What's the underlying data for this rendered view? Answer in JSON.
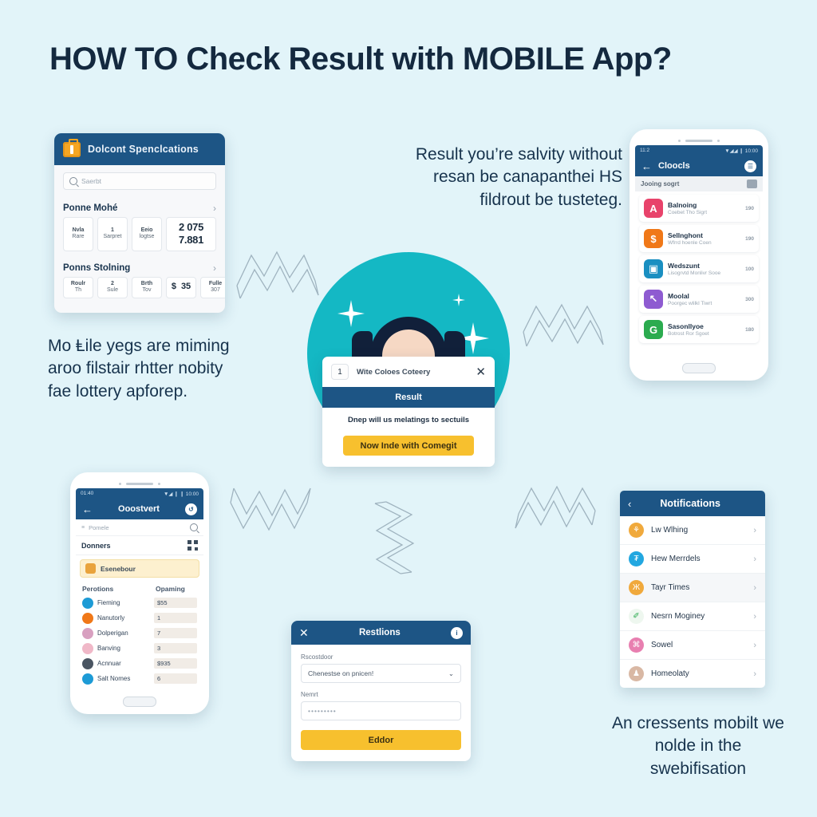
{
  "page": {
    "title": "HOW TO Check Result with MOBILE App?",
    "background_color": "#e2f4f9",
    "accent_blue": "#1d5585",
    "accent_yellow": "#f7c02e",
    "accent_teal": "#14b8c4"
  },
  "captions": {
    "top_right": "Result you’re salvity without resan be canapanthei HS fildrout be tusteteg.",
    "left": "Mo Ⱡile yegs are miming aroo filstair rhtter nobity fae lottery apforep.",
    "bottom_right": "An cressents mobilt we nolde in the swebifisation"
  },
  "specs_card": {
    "header_title": "Dolcont Spenclcations",
    "header_icon": "briefcase-icon",
    "search_placeholder": "Saerbt",
    "search_icon": "search-icon",
    "sections": [
      {
        "name": "Ponne Mohé",
        "chevron": "›",
        "chips": [
          {
            "l1": "Nvla",
            "l2": "Rare"
          },
          {
            "l1": "1",
            "l2": "Sarpret"
          },
          {
            "l1": "Eeio",
            "l2": "logtse"
          }
        ],
        "value": "2 075 7.881"
      },
      {
        "name": "Ponns Stolning",
        "chevron": "›",
        "chips": [
          {
            "l1": "Roulr",
            "l2": "Th"
          },
          {
            "l1": "2",
            "l2": "Sule"
          },
          {
            "l1": "Brth",
            "l2": "Tov"
          }
        ],
        "currency": "$",
        "amount": "35",
        "last_chip": {
          "l1": "Fulle",
          "l2": "307"
        }
      }
    ]
  },
  "phone_right": {
    "status_time": "11:2",
    "status_icons": "▼◢◢ ❙ 10:00",
    "appbar_title": "Cloocls",
    "back_icon": "back-arrow-icon",
    "action_icon": "filter-icon",
    "subhead": "Jooing sogrt",
    "subhead_icon": "sort-icon",
    "rows": [
      {
        "letter": "A",
        "color": "#e8436b",
        "title": "Balnoing",
        "subtitle": "Coebet Tho Sigrt",
        "meta": "190"
      },
      {
        "letter": "$",
        "color": "#f07818",
        "title": "Sellnghont",
        "subtitle": "Wfrrd hoenle Coen",
        "meta": "190"
      },
      {
        "letter": "▣",
        "color": "#1a8fc1",
        "title": "Wedszunt",
        "subtitle": "Lisogrvtd Monlivr Sooe",
        "meta": "100"
      },
      {
        "letter": "↖",
        "color": "#8e5bd1",
        "title": "Moolal",
        "subtitle": "Poorgec wlilkl Tiwrt",
        "meta": "300"
      },
      {
        "letter": "G",
        "color": "#2bab4f",
        "title": "Sasonllyoe",
        "subtitle": "Botrost Ror Sgoet",
        "meta": "180"
      }
    ]
  },
  "phone_bottom_left": {
    "status_time": "01:40",
    "status_icons": "▼◢ ❙ ❙ 10:00",
    "appbar_title": "Ooostvert",
    "back_icon": "back-arrow-icon",
    "action_icon": "refresh-icon",
    "search_placeholder": "Pomele",
    "search_icon": "search-icon",
    "section_title": "Donners",
    "section_icon": "qr-code-icon",
    "highlight_row": {
      "label": "Esenebour",
      "icon": "person-icon"
    },
    "table_headers": [
      "Perotions",
      "Opaming"
    ],
    "table_rows": [
      {
        "name": "Fieming",
        "value": "$55",
        "color": "#1d9bd6"
      },
      {
        "name": "Nanutorly",
        "value": "1",
        "color": "#f07818"
      },
      {
        "name": "Dolperigan",
        "value": "7",
        "color": "#d8a0c0"
      },
      {
        "name": "Banving",
        "value": "3",
        "color": "#f0b8c8"
      },
      {
        "name": "Acnnuar",
        "value": "$935",
        "color": "#4a5562"
      },
      {
        "name": "Salt Nomes",
        "value": "6",
        "color": "#1d9bd6"
      }
    ]
  },
  "center_dialog": {
    "badge_number": "1",
    "title": "Wite Coloes Coteery",
    "close_icon": "close-icon",
    "band_label": "Result",
    "body_text": "Dnep will us melatings to sectuils",
    "button_label": "Now Inde with Comegit"
  },
  "hero_illustration": {
    "name": "woman-with-laptop-illustration",
    "circle_color": "#14b8c4",
    "shirt_color": "#ef4a7b",
    "hair_color": "#11203a"
  },
  "form_card": {
    "header_title": "Restlions",
    "close_icon": "close-icon",
    "header_action_icon": "info-icon",
    "field1_label": "Rscostdoor",
    "field1_value": "Chenestse on pnicen!",
    "field1_chevron": "⌄",
    "field2_label": "Nemrt",
    "field2_value": "•••••••••",
    "button_label": "Eddor"
  },
  "notifications": {
    "header_title": "Notifications",
    "back_icon": "back-chevron-icon",
    "rows": [
      {
        "name": "Lw Wlhing",
        "color": "#f0a93c",
        "glyph": "⚘",
        "chevron": "›",
        "highlight": false
      },
      {
        "name": "Hew Merrdels",
        "color": "#22a7e0",
        "glyph": "₮",
        "chevron": "›",
        "highlight": false
      },
      {
        "name": "Tayr Times",
        "color": "#f0a93c",
        "glyph": "Ж",
        "chevron": "›",
        "highlight": true
      },
      {
        "name": "Nesrn Moginey",
        "color": "#eef7ef",
        "glyph": "✐",
        "chevron": "›",
        "highlight": false
      },
      {
        "name": "Sowel",
        "color": "#e87fb0",
        "glyph": "⌘",
        "chevron": "›",
        "highlight": false
      },
      {
        "name": "Homeolaty",
        "color": "#d9b8a4",
        "glyph": "♟",
        "chevron": "›",
        "highlight": false
      }
    ]
  }
}
